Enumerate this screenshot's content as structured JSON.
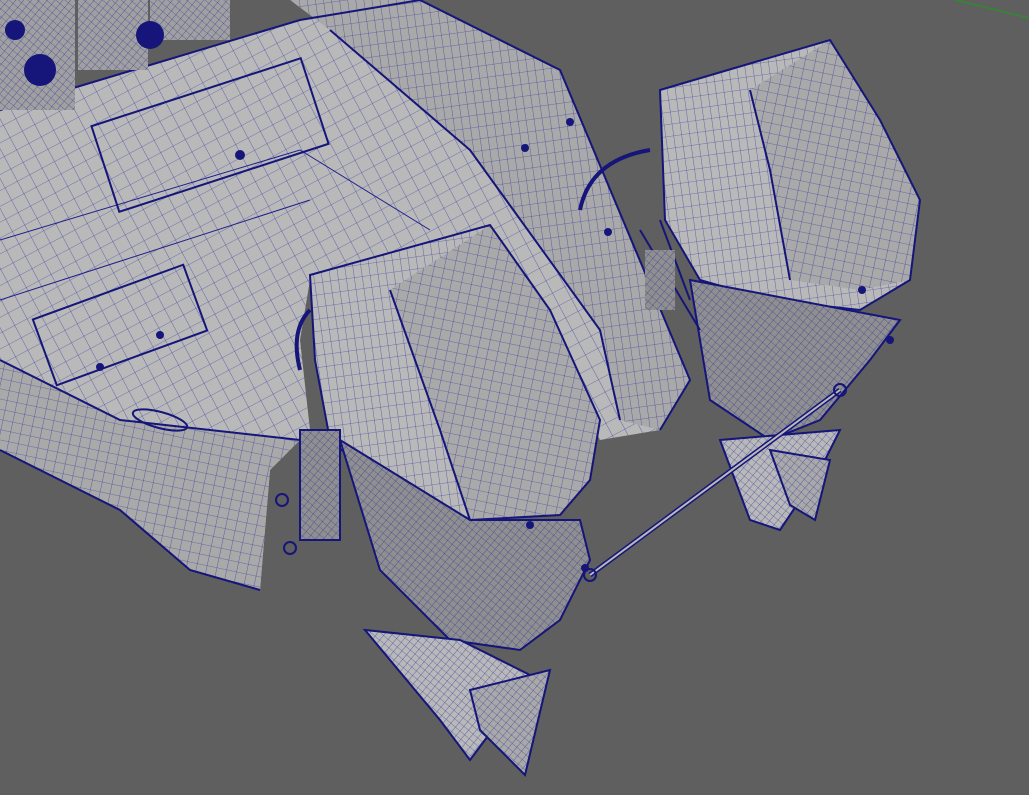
{
  "viewport": {
    "background_color": "#5f5f5f",
    "wireframe_color": "#1f1f8c",
    "surface_color": "#b9b9b9",
    "grid_axis_color": "#2e8b2e"
  },
  "scene": {
    "objects": [
      {
        "name": "boat-hull",
        "icon": "hull-mesh"
      },
      {
        "name": "left-outboard-motor",
        "icon": "outboard-mesh"
      },
      {
        "name": "right-outboard-motor",
        "icon": "outboard-mesh"
      },
      {
        "name": "tie-bar",
        "icon": "rod-mesh"
      }
    ]
  }
}
